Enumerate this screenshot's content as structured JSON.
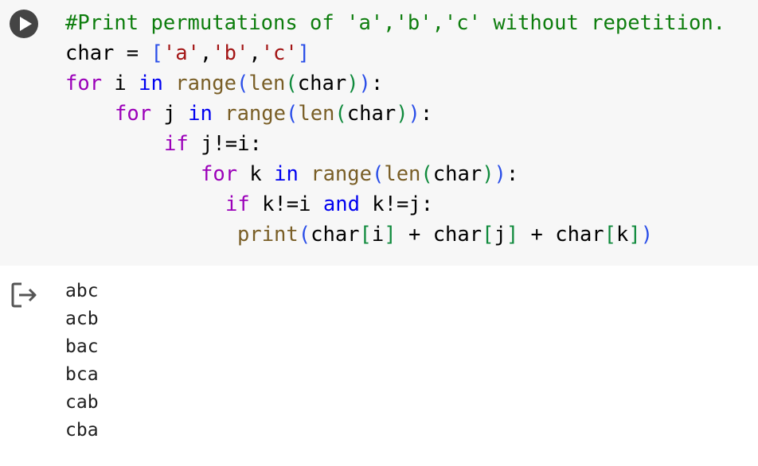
{
  "code": {
    "comment": "#Print permutations of 'a','b','c' without repetition.",
    "var_char": "char",
    "op_assign": " = ",
    "str_a": "'a'",
    "str_b": "'b'",
    "str_c": "'c'",
    "comma": ",",
    "kw_for": "for",
    "kw_in": "in",
    "kw_if": "if",
    "kw_and": "and",
    "fn_range": "range",
    "fn_len": "len",
    "fn_print": "print",
    "var_i": "i",
    "var_j": "j",
    "var_k": "k",
    "lbracket": "[",
    "rbracket": "]",
    "lparen": "(",
    "rparen": ")",
    "colon": ":",
    "cond_j_ne_i": "j!=i",
    "cond_k_ne_i": "k!=i",
    "cond_k_ne_j": "k!=j",
    "plus": " + "
  },
  "output": {
    "lines": [
      "abc",
      "acb",
      "bac",
      "bca",
      "cab",
      "cba"
    ]
  },
  "icons": {
    "run": "play-circle-icon",
    "output": "output-arrow-icon"
  },
  "colors": {
    "cell_bg": "#f7f7f7",
    "comment": "#0d7d0d",
    "keyword": "#9b00b9",
    "keyword_blue": "#0000f0",
    "function": "#795e26",
    "string": "#a31515"
  }
}
